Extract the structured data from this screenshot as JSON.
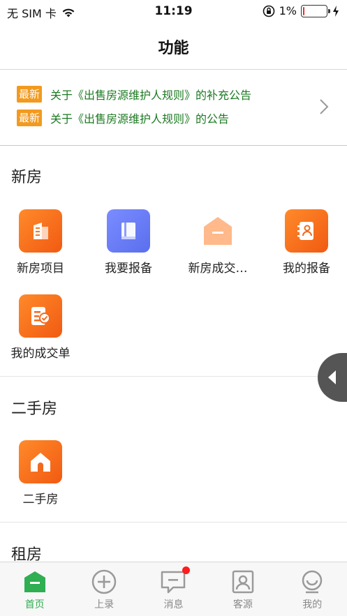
{
  "status_bar": {
    "carrier": "无 SIM 卡",
    "time": "11:19",
    "battery_percent": "1%",
    "battery_level": 0.05
  },
  "nav": {
    "title": "功能"
  },
  "announcements": [
    {
      "badge": "最新",
      "text": "关于《出售房源维护人规则》的补充公告"
    },
    {
      "badge": "最新",
      "text": "关于《出售房源维护人规则》的公告"
    }
  ],
  "sections": {
    "new_house": {
      "title": "新房",
      "items": [
        {
          "label": "新房项目",
          "icon": "building-doc-icon"
        },
        {
          "label": "我要报备",
          "icon": "book-icon"
        },
        {
          "label": "新房成交…",
          "icon": "house-minus-icon"
        },
        {
          "label": "我的报备",
          "icon": "contact-book-icon"
        },
        {
          "label": "我的成交单",
          "icon": "check-document-icon"
        }
      ]
    },
    "second_hand": {
      "title": "二手房",
      "items": [
        {
          "label": "二手房",
          "icon": "house-icon"
        }
      ]
    },
    "rental": {
      "title": "租房"
    }
  },
  "tab_bar": [
    {
      "label": "首页",
      "icon": "home-icon",
      "active": true
    },
    {
      "label": "上录",
      "icon": "plus-circle-icon",
      "active": false
    },
    {
      "label": "消息",
      "icon": "message-icon",
      "active": false,
      "badge": true
    },
    {
      "label": "客源",
      "icon": "client-card-icon",
      "active": false
    },
    {
      "label": "我的",
      "icon": "profile-icon",
      "active": false
    }
  ],
  "colors": {
    "accent_green": "#2fae52",
    "announce_green": "#1c7a22",
    "badge_orange": "#f29a1f",
    "tile_orange": "#f15a12",
    "tile_blue": "#5a6fee"
  }
}
